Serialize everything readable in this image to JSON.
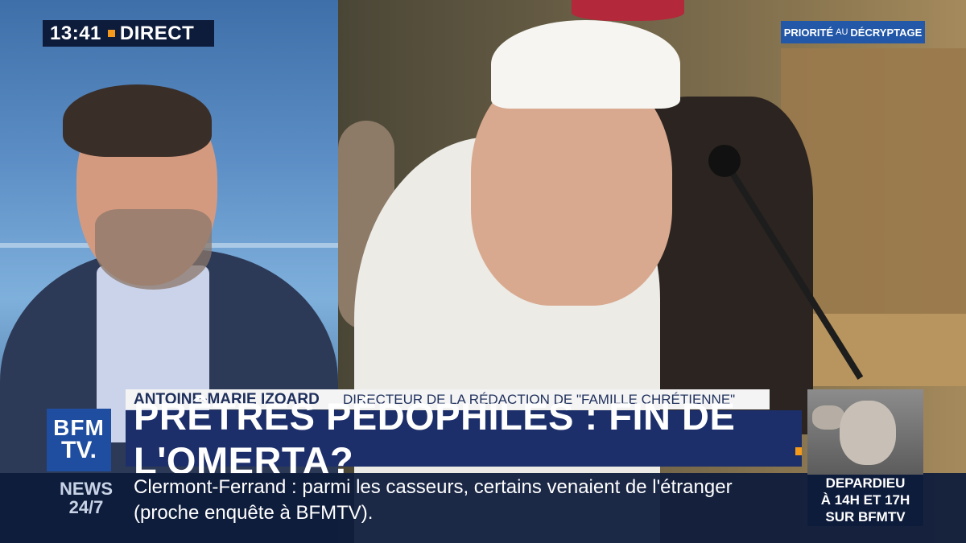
{
  "broadcast": {
    "time": "13:41",
    "live_label": "DIRECT",
    "priority_tag": {
      "part1": "PRIORITÉ",
      "part2": "AU",
      "part3": "DÉCRYPTAGE"
    }
  },
  "lower_third": {
    "person_name": "ANTOINE-MARIE IZOARD",
    "person_role": "DIRECTEUR DE LA RÉDACTION DE \"FAMILLE CHRÉTIENNE\"",
    "headline": "PRÊTRES PÉDOPHILES : FIN DE L'OMERTA?"
  },
  "channel_logo": {
    "line1": "BFM",
    "line2": "TV."
  },
  "ticker": {
    "label_line1": "NEWS",
    "label_line2": "24/7",
    "text_line1": "Clermont-Ferrand : parmi les casseurs, certains venaient de l'étranger",
    "text_line2": "(proche enquête à BFMTV)."
  },
  "promo": {
    "line1": "DEPARDIEU",
    "line2": "À 14H ET 17H",
    "line3": "SUR BFMTV"
  },
  "colors": {
    "bfm_navy": "#1d2f6a",
    "bfm_blue": "#1f4ea0",
    "accent_orange": "#f39a1c"
  }
}
